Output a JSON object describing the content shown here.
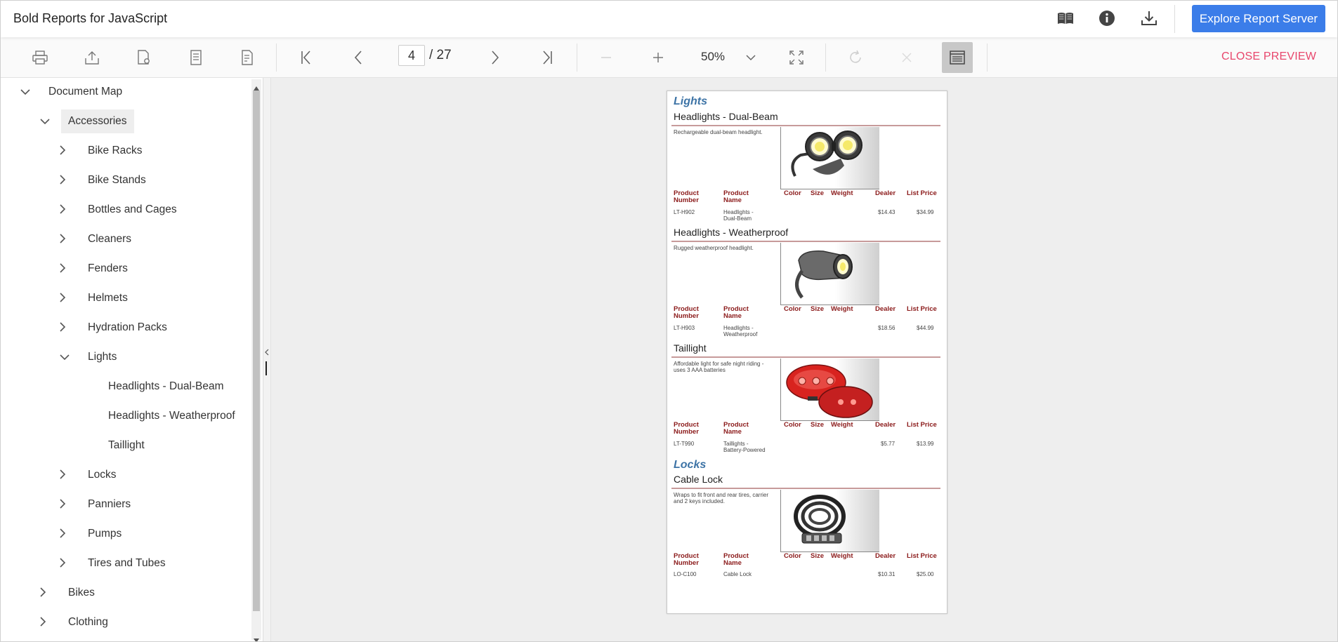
{
  "header": {
    "title": "Bold Reports for JavaScript",
    "explore_button": "Explore Report Server",
    "icons": [
      "book-open-icon",
      "info-icon",
      "download-icon"
    ]
  },
  "toolbar": {
    "current_page": "4",
    "total_pages": "/ 27",
    "zoom": "50%",
    "close_preview": "CLOSE PREVIEW",
    "icons": [
      "print-icon",
      "export-icon",
      "page-setup-icon",
      "print-layout-icon",
      "parameter-icon",
      "first-page-icon",
      "previous-page-icon",
      "next-page-icon",
      "last-page-icon",
      "zoom-out-icon",
      "zoom-in-icon",
      "zoom-dropdown-icon",
      "fit-page-icon",
      "refresh-icon",
      "stop-icon",
      "document-map-toggle-icon"
    ]
  },
  "document_map": {
    "root": "Document Map",
    "items": [
      {
        "label": "Accessories",
        "level": 1,
        "expanded": true,
        "selected": true
      },
      {
        "label": "Bike Racks",
        "level": 2,
        "expanded": false
      },
      {
        "label": "Bike Stands",
        "level": 2,
        "expanded": false
      },
      {
        "label": "Bottles and Cages",
        "level": 2,
        "expanded": false
      },
      {
        "label": "Cleaners",
        "level": 2,
        "expanded": false
      },
      {
        "label": "Fenders",
        "level": 2,
        "expanded": false
      },
      {
        "label": "Helmets",
        "level": 2,
        "expanded": false
      },
      {
        "label": "Hydration Packs",
        "level": 2,
        "expanded": false
      },
      {
        "label": "Lights",
        "level": 2,
        "expanded": true
      },
      {
        "label": "Headlights - Dual-Beam",
        "level": 3,
        "leaf": true
      },
      {
        "label": "Headlights - Weatherproof",
        "level": 3,
        "leaf": true
      },
      {
        "label": "Taillight",
        "level": 3,
        "leaf": true
      },
      {
        "label": "Locks",
        "level": 2,
        "expanded": false
      },
      {
        "label": "Panniers",
        "level": 2,
        "expanded": false
      },
      {
        "label": "Pumps",
        "level": 2,
        "expanded": false
      },
      {
        "label": "Tires and Tubes",
        "level": 2,
        "expanded": false
      },
      {
        "label": "Bikes",
        "level": 1,
        "expanded": false
      },
      {
        "label": "Clothing",
        "level": 1,
        "expanded": false
      }
    ]
  },
  "report": {
    "columns": {
      "product_number": "Product\nNumber",
      "product_name": "Product\nName",
      "color": "Color",
      "size": "Size",
      "weight": "Weight",
      "dealer": "Dealer",
      "list_price": "List Price"
    },
    "sections": [
      {
        "category": "Lights",
        "products": [
          {
            "name": "Headlights - Dual-Beam",
            "description": "Rechargeable dual-beam headlight.",
            "number": "LT-H902",
            "product_name": "Headlights -\nDual-Beam",
            "dealer": "$14.43",
            "list_price": "$34.99",
            "image": "headlight-dual-beam-image"
          },
          {
            "name": "Headlights - Weatherproof",
            "description": "Rugged weatherproof headlight.",
            "number": "LT-H903",
            "product_name": "Headlights -\nWeatherproof",
            "dealer": "$18.56",
            "list_price": "$44.99",
            "image": "headlight-weatherproof-image"
          },
          {
            "name": "Taillight",
            "description": "Affordable light for safe night riding - uses 3 AAA batteries",
            "number": "LT-T990",
            "product_name": "Taillights -\nBattery-Powered",
            "dealer": "$5.77",
            "list_price": "$13.99",
            "image": "taillight-image"
          }
        ]
      },
      {
        "category": "Locks",
        "products": [
          {
            "name": "Cable Lock",
            "description": "Wraps to fit front and rear tires, carrier and 2 keys included.",
            "number": "LO-C100",
            "product_name": "Cable Lock",
            "dealer": "$10.31",
            "list_price": "$25.00",
            "image": "cable-lock-image"
          }
        ]
      }
    ]
  },
  "colors": {
    "accent": "#3b7de9",
    "close_preview": "#e8466c",
    "category_title": "#3e74a6",
    "column_header": "#8b1a1a"
  }
}
